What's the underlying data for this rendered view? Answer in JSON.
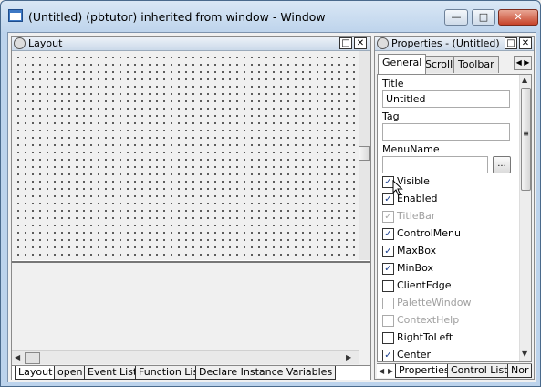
{
  "window": {
    "title": "(Untitled) (pbtutor) inherited from window - Window",
    "minimize": "—",
    "maximize": "□",
    "close": "✕"
  },
  "layout_pane": {
    "title": "Layout",
    "restore": "□",
    "close": "✕",
    "tabs": [
      "Layout",
      "open",
      "Event List",
      "Function List",
      "Declare Instance Variables"
    ]
  },
  "properties_pane": {
    "title": "Properties - (Untitled) inh",
    "restore": "□",
    "close": "✕",
    "tabs": [
      "General",
      "Scroll",
      "Toolbar"
    ],
    "title_label": "Title",
    "title_value": "Untitled",
    "tag_label": "Tag",
    "tag_value": "",
    "menuname_label": "MenuName",
    "menuname_value": "",
    "ellipsis": "...",
    "checkboxes": [
      {
        "label": "Visible",
        "checked": true,
        "enabled": true
      },
      {
        "label": "Enabled",
        "checked": true,
        "enabled": true
      },
      {
        "label": "TitleBar",
        "checked": true,
        "enabled": false
      },
      {
        "label": "ControlMenu",
        "checked": true,
        "enabled": true
      },
      {
        "label": "MaxBox",
        "checked": true,
        "enabled": true
      },
      {
        "label": "MinBox",
        "checked": true,
        "enabled": true
      },
      {
        "label": "ClientEdge",
        "checked": false,
        "enabled": true
      },
      {
        "label": "PaletteWindow",
        "checked": false,
        "enabled": false
      },
      {
        "label": "ContextHelp",
        "checked": false,
        "enabled": false
      },
      {
        "label": "RightToLeft",
        "checked": false,
        "enabled": true
      },
      {
        "label": "Center",
        "checked": true,
        "enabled": true
      }
    ],
    "bottom_tabs": [
      "Properties",
      "Control List",
      "Nor"
    ]
  }
}
